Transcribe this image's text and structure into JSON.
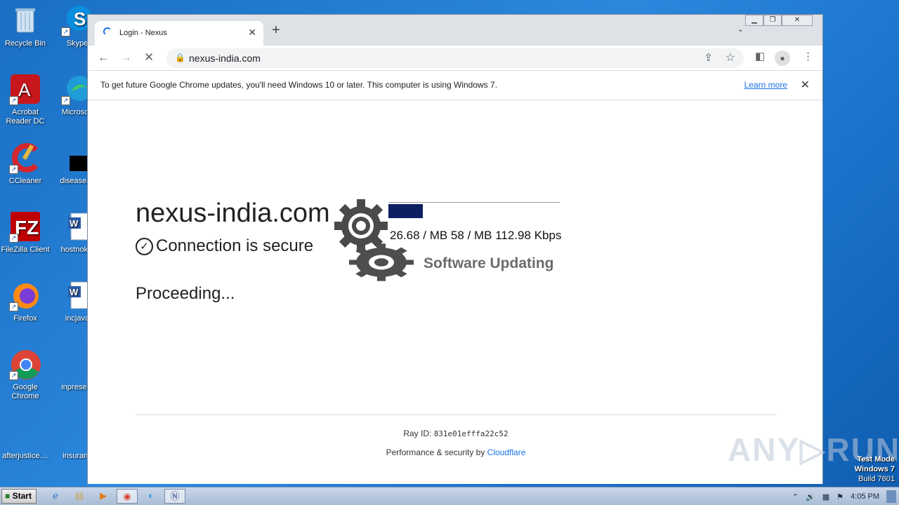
{
  "desktop": {
    "icons": [
      {
        "label": "Recycle Bin"
      },
      {
        "label": "Skype"
      },
      {
        "label": "Acrobat Reader DC"
      },
      {
        "label": "Microsoft"
      },
      {
        "label": "CCleaner"
      },
      {
        "label": "diseaseas"
      },
      {
        "label": "FileZilla Client"
      },
      {
        "label": "hostnokia"
      },
      {
        "label": "Firefox"
      },
      {
        "label": "incjava"
      },
      {
        "label": "Google Chrome"
      },
      {
        "label": "inpresent"
      },
      {
        "label": "afterjustice...."
      },
      {
        "label": "insuranc"
      }
    ]
  },
  "browser": {
    "tab_title": "Login - Nexus",
    "tab_close": "✕",
    "new_tab": "+",
    "tab_search": "⌄",
    "url": "nexus-india.com",
    "infobar": {
      "message": "To get future Google Chrome updates, you'll need Windows 10 or later. This computer is using Windows 7.",
      "link": "Learn more",
      "close": "✕"
    }
  },
  "page": {
    "site_name": "nexus-india.com",
    "secure_text": "Connection is secure",
    "proceeding": "Proceeding...",
    "download": {
      "stats": "26.68 / MB 58 / MB 112.98 Kbps",
      "progress": 0.2,
      "status": "Software Updating"
    },
    "ray_label": "Ray ID:",
    "ray_id": "831e01efffa22c52",
    "perf_text": "Performance & security by",
    "perf_link": "Cloudflare"
  },
  "watermark": {
    "brand": "ANY▷RUN",
    "test_mode": "Test Mode",
    "os": "Windows 7",
    "build": "Build 7601"
  },
  "taskbar": {
    "start": "Start",
    "clock": "4:05 PM"
  },
  "colors": {
    "progress_fill": "#0d1f63",
    "link": "#1a73e8"
  }
}
